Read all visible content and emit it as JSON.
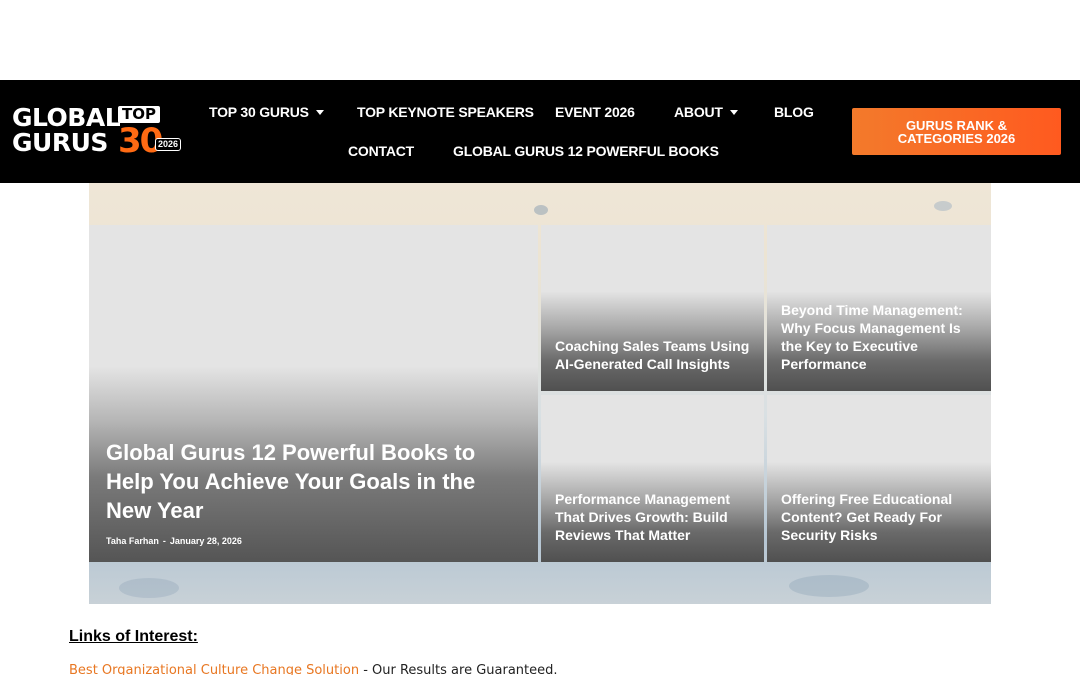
{
  "logo": {
    "line1": "GLOBAL",
    "line2": "GURUS",
    "top_badge": "TOP",
    "number": "30",
    "year": "2026"
  },
  "nav": {
    "items": [
      {
        "label": "TOP 30 GURUS",
        "has_dropdown": true
      },
      {
        "label": "TOP KEYNOTE SPEAKERS",
        "has_dropdown": false
      },
      {
        "label": "EVENT 2026",
        "has_dropdown": false
      },
      {
        "label": "ABOUT",
        "has_dropdown": true
      },
      {
        "label": "BLOG",
        "has_dropdown": false
      },
      {
        "label": "CONTACT",
        "has_dropdown": false
      },
      {
        "label": "GLOBAL GURUS 12 POWERFUL BOOKS",
        "has_dropdown": false
      }
    ],
    "cta_line1": "GURUS RANK &",
    "cta_line2": "CATEGORIES 2026",
    "icons": {
      "dropdown": "caret-down-icon"
    }
  },
  "featured": {
    "main": {
      "title": "Global Gurus 12 Powerful Books to Help You Achieve Your Goals in the New Year",
      "author": "Taha Farhan",
      "separator": "-",
      "date": "January 28, 2026"
    },
    "posts": [
      {
        "title": "Coaching Sales Teams Using AI-Generated Call Insights"
      },
      {
        "title": "Beyond Time Management: Why Focus Management Is the Key to Executive Performance"
      },
      {
        "title": "Performance Management That Drives Growth: Build Reviews That Matter"
      },
      {
        "title": "Offering Free Educational Content? Get Ready For Security Risks"
      }
    ]
  },
  "links": {
    "heading": "Links of Interest:",
    "items": [
      {
        "link_text": "Best Organizational Culture Change Solution",
        "suffix": " - Our Results are Guaranteed."
      }
    ]
  },
  "colors": {
    "header_bg": "#000000",
    "accent_orange": "#ff6a13",
    "link_orange": "#e87722"
  }
}
